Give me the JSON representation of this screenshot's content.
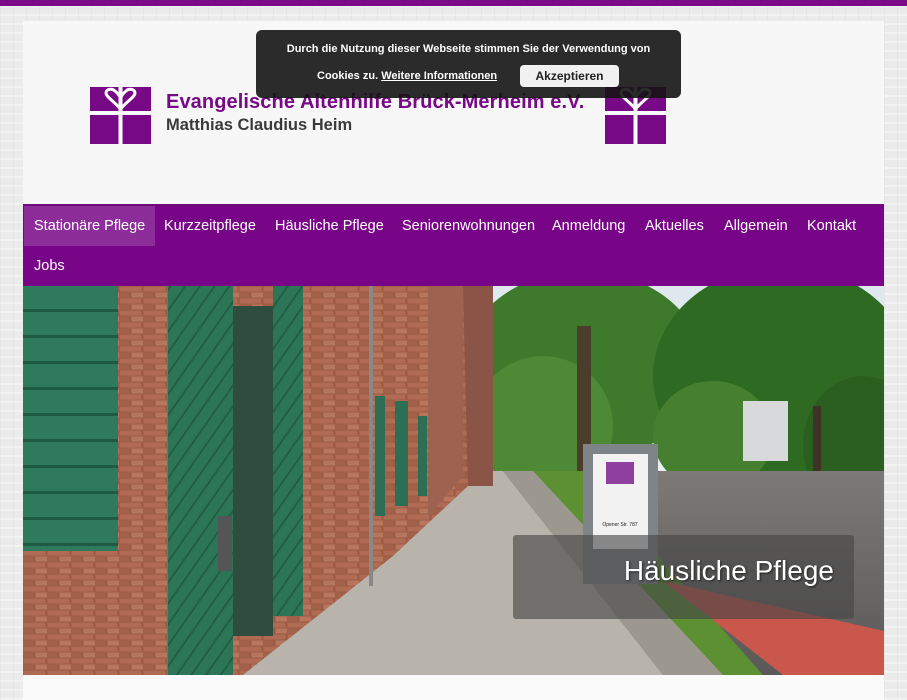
{
  "colors": {
    "brand": "#770886",
    "nav_bg": "#780587",
    "top_bar": "#7a0a88"
  },
  "header": {
    "org_name": "Evangelische Altenhilfe Brück-Merheim e.V.",
    "org_sub": "Matthias Claudius Heim",
    "logo_icon": "cross-heart-logo-icon"
  },
  "nav": {
    "items": [
      {
        "label": "Stationäre Pflege",
        "active": true
      },
      {
        "label": "Kurzzeitpflege"
      },
      {
        "label": "Häusliche Pflege"
      },
      {
        "label": "Seniorenwohnungen"
      },
      {
        "label": "Anmeldung"
      },
      {
        "label": "Aktuelles"
      },
      {
        "label": "Allgemein"
      },
      {
        "label": "Kontakt"
      },
      {
        "label": "Jobs"
      }
    ]
  },
  "hero": {
    "caption": "Häusliche Pflege",
    "sign_text": "Opener Str. 787"
  },
  "cookie": {
    "line1": "Durch die Nutzung dieser Webseite stimmen Sie der Verwendung von",
    "line2_prefix": "Cookies zu.",
    "link_label": "Weitere Informationen",
    "accept_label": "Akzeptieren"
  }
}
